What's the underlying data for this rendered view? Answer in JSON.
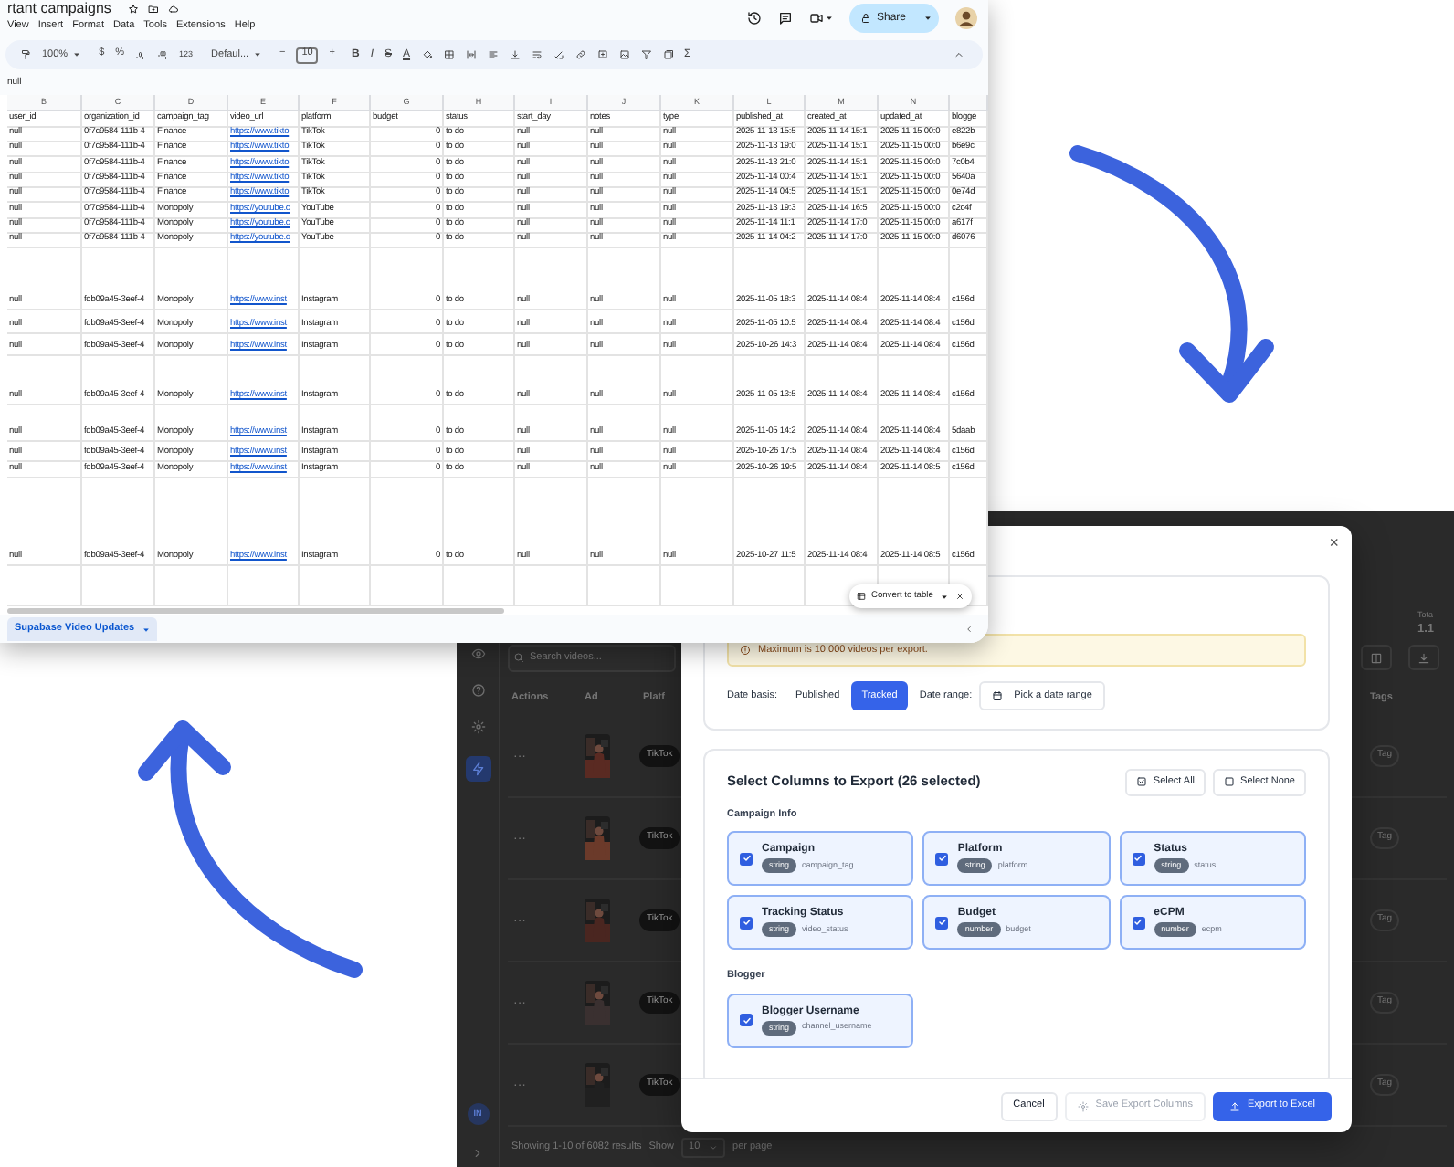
{
  "spreadsheet": {
    "title": "rtant campaigns",
    "share_button": "Share",
    "menu": [
      "View",
      "Insert",
      "Format",
      "Data",
      "Tools",
      "Extensions",
      "Help"
    ],
    "toolbar": {
      "zoom": "100%",
      "currency": "$",
      "percent": "%",
      "number_format": "123",
      "font": "Defaul...",
      "minus": "−",
      "font_size": "10",
      "plus": "+",
      "text_buttons": [
        "B",
        "I",
        "S",
        "A"
      ],
      "functions": "Σ"
    },
    "formula_bar": "null",
    "column_letters": [
      "B",
      "C",
      "D",
      "E",
      "F",
      "G",
      "H",
      "I",
      "J",
      "K",
      "L",
      "M",
      "N"
    ],
    "header": [
      "user_id",
      "organization_id",
      "campaign_tag",
      "video_url",
      "platform",
      "budget",
      "status",
      "start_day",
      "notes",
      "type",
      "published_at",
      "created_at",
      "updated_at",
      "blogge"
    ],
    "rows": [
      [
        "null",
        "0f7c9584-111b-4",
        "Finance",
        "https://www.tikto",
        "TikTok",
        "0",
        "to do",
        "null",
        "null",
        "null",
        "2025-11-13 15:5",
        "2025-11-14 15:1",
        "2025-11-15 00:0",
        "e822b"
      ],
      [
        "null",
        "0f7c9584-111b-4",
        "Finance",
        "https://www.tikto",
        "TikTok",
        "0",
        "to do",
        "null",
        "null",
        "null",
        "2025-11-13 19:0",
        "2025-11-14 15:1",
        "2025-11-15 00:0",
        "b6e9c"
      ],
      [
        "null",
        "0f7c9584-111b-4",
        "Finance",
        "https://www.tikto",
        "TikTok",
        "0",
        "to do",
        "null",
        "null",
        "null",
        "2025-11-13 21:0",
        "2025-11-14 15:1",
        "2025-11-15 00:0",
        "7c0b4"
      ],
      [
        "null",
        "0f7c9584-111b-4",
        "Finance",
        "https://www.tikto",
        "TikTok",
        "0",
        "to do",
        "null",
        "null",
        "null",
        "2025-11-14 00:4",
        "2025-11-14 15:1",
        "2025-11-15 00:0",
        "5640a"
      ],
      [
        "null",
        "0f7c9584-111b-4",
        "Finance",
        "https://www.tikto",
        "TikTok",
        "0",
        "to do",
        "null",
        "null",
        "null",
        "2025-11-14 04:5",
        "2025-11-14 15:1",
        "2025-11-15 00:0",
        "0e74d"
      ],
      [
        "null",
        "0f7c9584-111b-4",
        "Monopoly",
        "https://youtube.c",
        "YouTube",
        "0",
        "to do",
        "null",
        "null",
        "null",
        "2025-11-13 19:3",
        "2025-11-14 16:5",
        "2025-11-15 00:0",
        "c2c4f"
      ],
      [
        "null",
        "0f7c9584-111b-4",
        "Monopoly",
        "https://youtube.c",
        "YouTube",
        "0",
        "to do",
        "null",
        "null",
        "null",
        "2025-11-14 11:1",
        "2025-11-14 17:0",
        "2025-11-15 00:0",
        "a617f"
      ],
      [
        "null",
        "0f7c9584-111b-4",
        "Monopoly",
        "https://youtube.c",
        "YouTube",
        "0",
        "to do",
        "null",
        "null",
        "null",
        "2025-11-14 04:2",
        "2025-11-14 17:0",
        "2025-11-15 00:0",
        "d6076"
      ],
      [
        "null",
        "fdb09a45-3eef-4",
        "Monopoly",
        "https://www.inst",
        "Instagram",
        "0",
        "to do",
        "null",
        "null",
        "null",
        "2025-11-05 18:3",
        "2025-11-14 08:4",
        "2025-11-14 08:4",
        "c156d"
      ],
      [
        "null",
        "fdb09a45-3eef-4",
        "Monopoly",
        "https://www.inst",
        "Instagram",
        "0",
        "to do",
        "null",
        "null",
        "null",
        "2025-11-05 10:5",
        "2025-11-14 08:4",
        "2025-11-14 08:4",
        "c156d"
      ],
      [
        "null",
        "fdb09a45-3eef-4",
        "Monopoly",
        "https://www.inst",
        "Instagram",
        "0",
        "to do",
        "null",
        "null",
        "null",
        "2025-10-26 14:3",
        "2025-11-14 08:4",
        "2025-11-14 08:4",
        "c156d"
      ],
      [
        "null",
        "fdb09a45-3eef-4",
        "Monopoly",
        "https://www.inst",
        "Instagram",
        "0",
        "to do",
        "null",
        "null",
        "null",
        "2025-11-05 13:5",
        "2025-11-14 08:4",
        "2025-11-14 08:4",
        "c156d"
      ],
      [
        "null",
        "fdb09a45-3eef-4",
        "Monopoly",
        "https://www.inst",
        "Instagram",
        "0",
        "to do",
        "null",
        "null",
        "null",
        "2025-11-05 14:2",
        "2025-11-14 08:4",
        "2025-11-14 08:4",
        "5daab"
      ],
      [
        "null",
        "fdb09a45-3eef-4",
        "Monopoly",
        "https://www.inst",
        "Instagram",
        "0",
        "to do",
        "null",
        "null",
        "null",
        "2025-10-26 17:5",
        "2025-11-14 08:4",
        "2025-11-14 08:4",
        "c156d"
      ],
      [
        "null",
        "fdb09a45-3eef-4",
        "Monopoly",
        "https://www.inst",
        "Instagram",
        "0",
        "to do",
        "null",
        "null",
        "null",
        "2025-10-26 19:5",
        "2025-11-14 08:4",
        "2025-11-14 08:5",
        "c156d"
      ],
      [
        "null",
        "fdb09a45-3eef-4",
        "Monopoly",
        "https://www.inst",
        "Instagram",
        "0",
        "to do",
        "null",
        "null",
        "null",
        "2025-10-27 11:5",
        "2025-11-14 08:4",
        "2025-11-14 08:5",
        "c156d"
      ]
    ],
    "convert_popup": "Convert to table",
    "sheet_tab": "Supabase Video Updates"
  },
  "app": {
    "stat_label": "Tota",
    "stat_value": "1.1",
    "search": {
      "placeholder": "Search videos..."
    },
    "columns": [
      "Actions",
      "Ad",
      "Platf",
      "Tags"
    ],
    "rows": [
      {
        "actions": "···",
        "platform": "TikTok",
        "tag": "Tag"
      },
      {
        "actions": "···",
        "platform": "TikTok",
        "tag": "Tag"
      },
      {
        "actions": "···",
        "platform": "TikTok",
        "tag": "Tag"
      },
      {
        "actions": "···",
        "platform": "TikTok",
        "tag": "Tag"
      },
      {
        "actions": "···",
        "platform": "TikTok",
        "tag": "Tag"
      }
    ],
    "avatar": "IN",
    "footer": {
      "summary": "Showing 1-10 of 6082 results",
      "show": "Show",
      "page_size": "10",
      "per_page": "per page"
    }
  },
  "modal": {
    "close": "×",
    "warning": "Maximum is 10,000 videos per export.",
    "date_basis_label": "Date basis:",
    "date_basis_options": [
      {
        "label": "Published",
        "selected": false
      },
      {
        "label": "Tracked",
        "selected": true
      }
    ],
    "date_range_label": "Date range:",
    "date_range_button": "Pick a date range",
    "columns_title": "Select Columns to Export (26 selected)",
    "select_all": "Select All",
    "select_none": "Select None",
    "groups": [
      {
        "title": "Campaign Info",
        "fields": [
          {
            "label": "Campaign",
            "data_type": "string",
            "key": "campaign_tag",
            "checked": true
          },
          {
            "label": "Platform",
            "data_type": "string",
            "key": "platform",
            "checked": true
          },
          {
            "label": "Status",
            "data_type": "string",
            "key": "status",
            "checked": true
          },
          {
            "label": "Tracking Status",
            "data_type": "string",
            "key": "video_status",
            "checked": true
          },
          {
            "label": "Budget",
            "data_type": "number",
            "key": "budget",
            "checked": true
          },
          {
            "label": "eCPM",
            "data_type": "number",
            "key": "ecpm",
            "checked": true
          }
        ]
      },
      {
        "title": "Blogger",
        "fields": [
          {
            "label": "Blogger Username",
            "data_type": "string",
            "key": "channel_username",
            "checked": true
          }
        ]
      }
    ],
    "buttons": [
      {
        "label": "Cancel",
        "kind": "outline",
        "disabled": false
      },
      {
        "label": "Save Export Columns",
        "kind": "save",
        "disabled": true
      },
      {
        "label": "Export to Excel",
        "kind": "primary",
        "disabled": false
      }
    ]
  }
}
